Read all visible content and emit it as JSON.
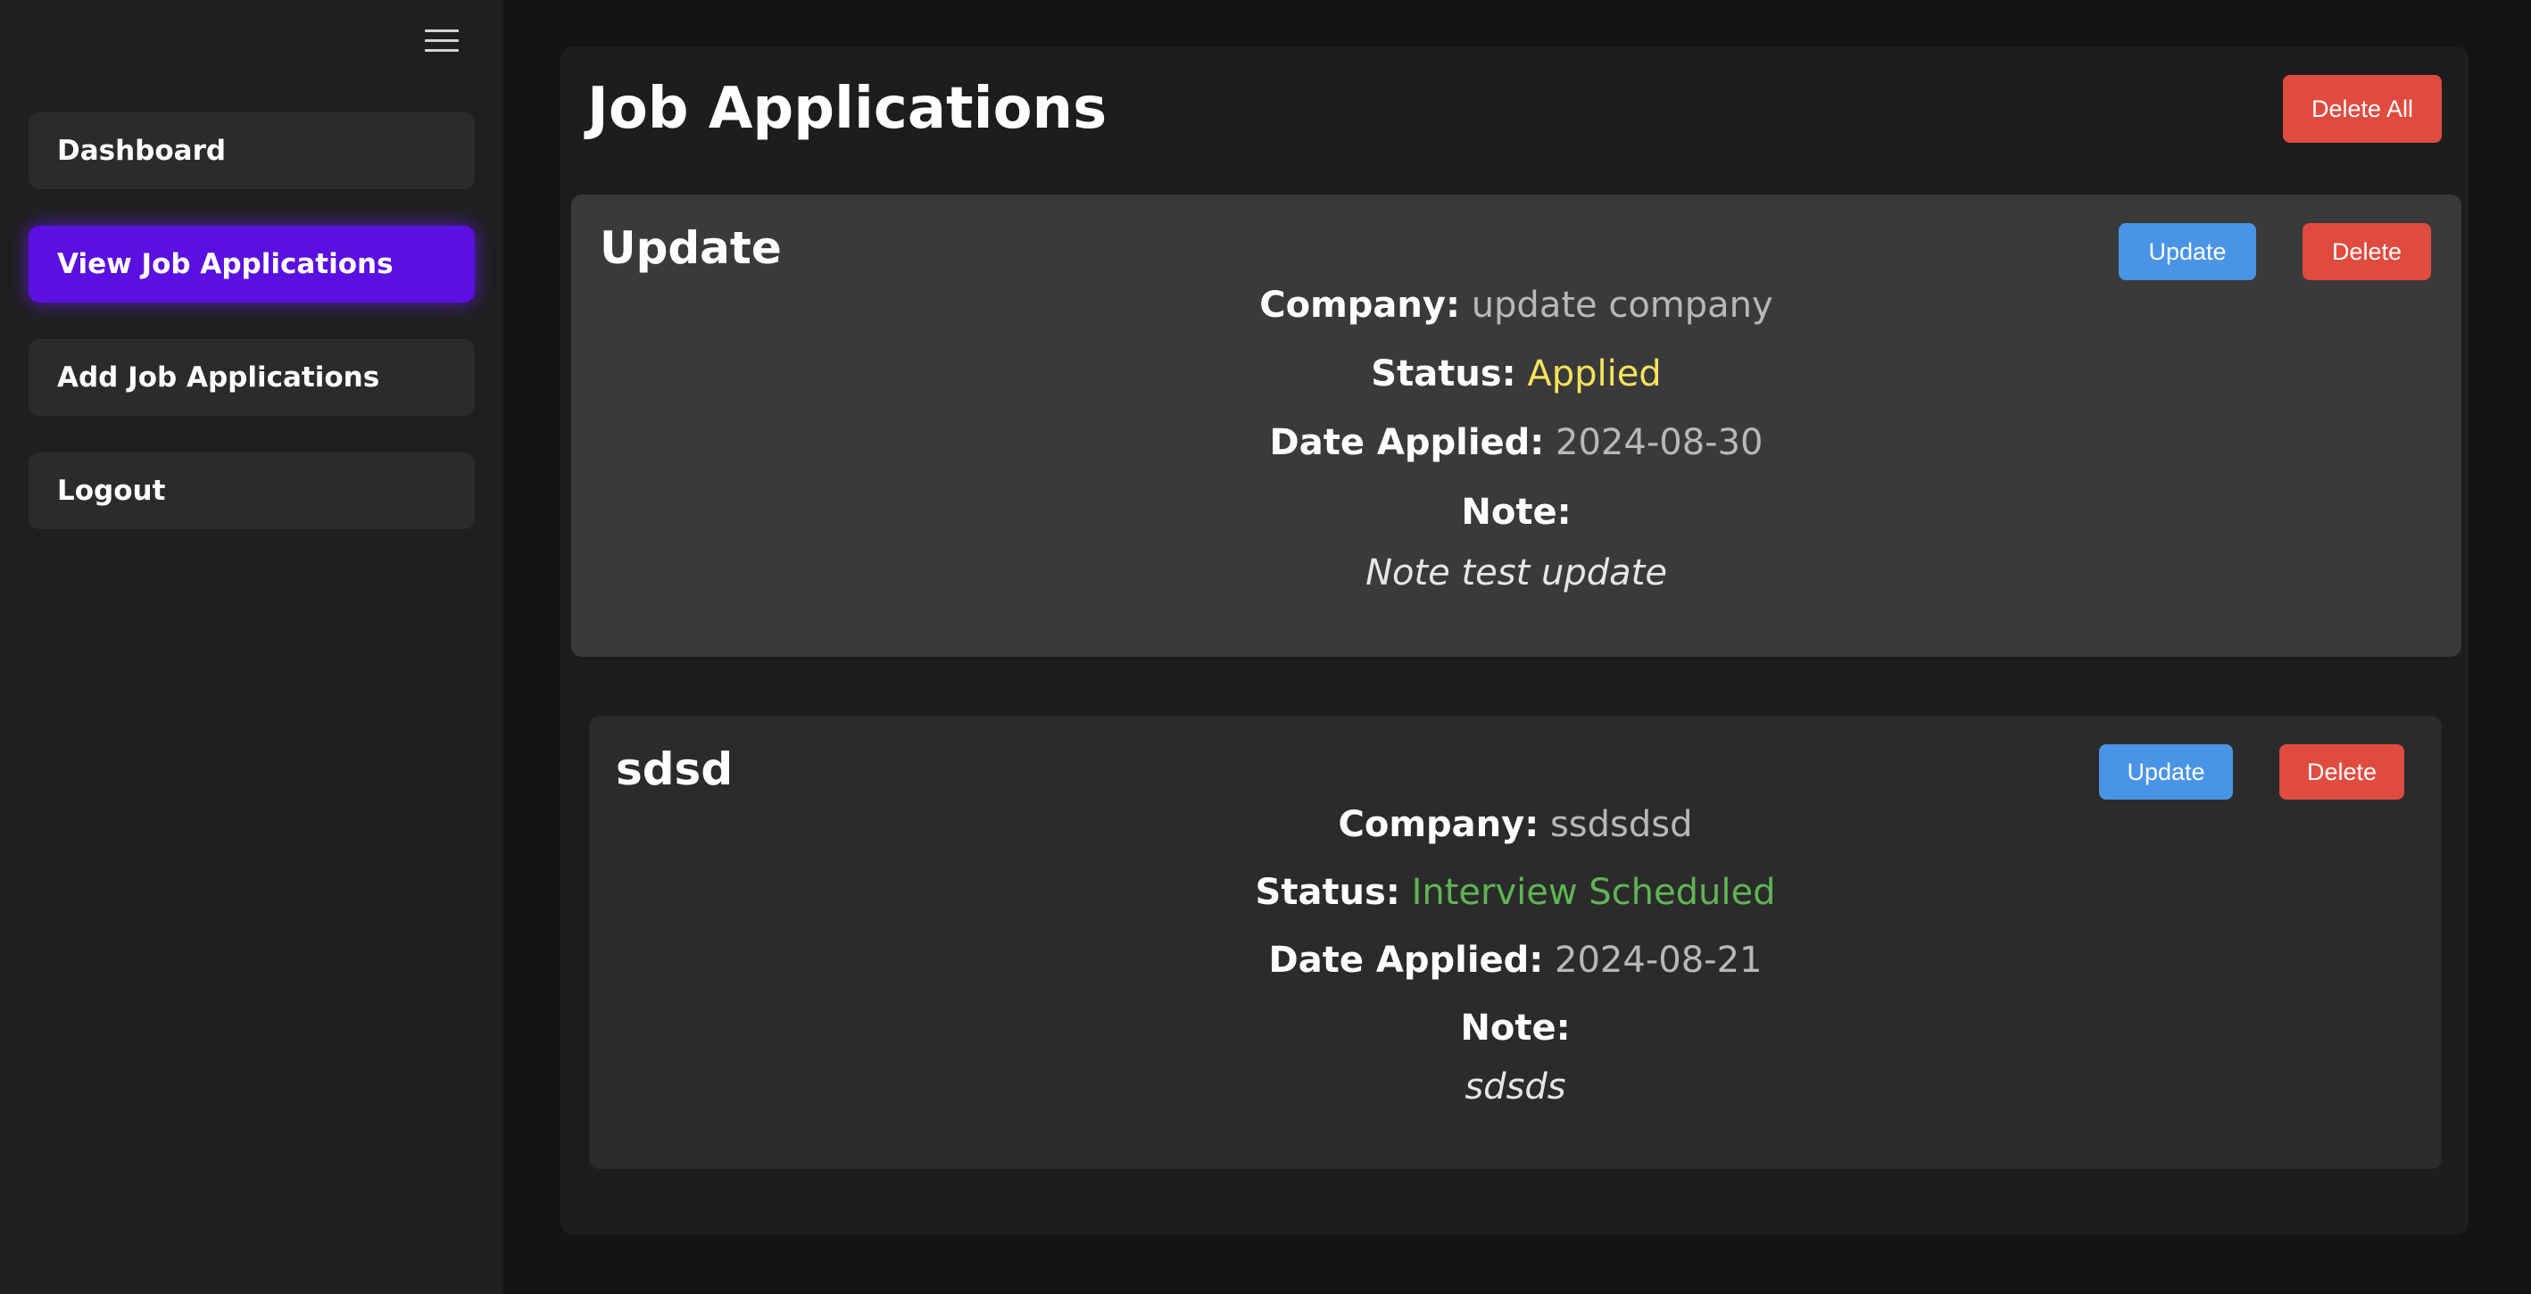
{
  "sidebar": {
    "menu_icon": "hamburger-menu-icon",
    "items": [
      {
        "label": "Dashboard"
      },
      {
        "label": "View Job Applications"
      },
      {
        "label": "Add Job Applications"
      },
      {
        "label": "Logout"
      }
    ],
    "active_index": 1
  },
  "main": {
    "title": "Job Applications",
    "delete_all_label": "Delete All",
    "labels": {
      "company": "Company:",
      "status": "Status:",
      "date_applied": "Date Applied:",
      "note": "Note:"
    },
    "applications": [
      {
        "title": "Update",
        "company": "update company",
        "status": "Applied",
        "date_applied": "2024-08-30",
        "note": "Note test update",
        "update_label": "Update",
        "delete_label": "Delete"
      },
      {
        "title": "sdsd",
        "company": "ssdsdsd",
        "status": "Interview Scheduled",
        "date_applied": "2024-08-21",
        "note": "sdsds",
        "update_label": "Update",
        "delete_label": "Delete"
      }
    ]
  },
  "colors": {
    "active_nav": "#5a10e0",
    "delete_button": "#e04b3f",
    "update_button": "#4a94e6",
    "status_applied": "#f5e35c",
    "status_interview": "#5fb554"
  }
}
